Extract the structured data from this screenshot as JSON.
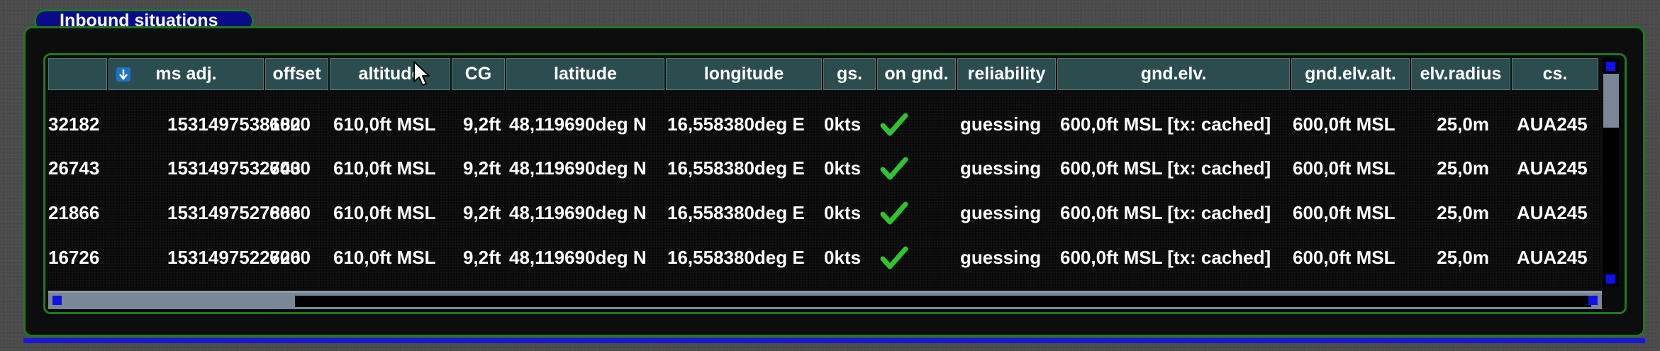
{
  "panel": {
    "title": "Inbound situations"
  },
  "table": {
    "columns": [
      {
        "key": "id",
        "label": ""
      },
      {
        "key": "ms_adj",
        "label": "ms adj."
      },
      {
        "key": "offset",
        "label": "offset"
      },
      {
        "key": "altitude",
        "label": "altitude"
      },
      {
        "key": "cg",
        "label": "CG"
      },
      {
        "key": "latitude",
        "label": "latitude"
      },
      {
        "key": "longitude",
        "label": "longitude"
      },
      {
        "key": "gs",
        "label": "gs."
      },
      {
        "key": "on_gnd",
        "label": "on gnd."
      },
      {
        "key": "reliability",
        "label": "reliability"
      },
      {
        "key": "gnd_elv",
        "label": "gnd.elv."
      },
      {
        "key": "gnd_elv_alt",
        "label": "gnd.elv.alt."
      },
      {
        "key": "elv_radius",
        "label": "elv.radius"
      },
      {
        "key": "cs",
        "label": "cs."
      }
    ],
    "sort_icon": "sort-arrow-down-icon",
    "rows": [
      {
        "id": "32182",
        "ms_adj": "1531497538182",
        "offset": "6000",
        "altitude": "610,0ft MSL",
        "cg": "9,2ft",
        "latitude": "48,119690deg N",
        "longitude": "16,558380deg E",
        "gs": "0kts",
        "on_gnd": true,
        "reliability": "guessing",
        "gnd_elv": "600,0ft MSL [tx: cached]",
        "gnd_elv_alt": "600,0ft MSL",
        "elv_radius": "25,0m",
        "cs": "AUA245"
      },
      {
        "id": "26743",
        "ms_adj": "1531497532743",
        "offset": "6000",
        "altitude": "610,0ft MSL",
        "cg": "9,2ft",
        "latitude": "48,119690deg N",
        "longitude": "16,558380deg E",
        "gs": "0kts",
        "on_gnd": true,
        "reliability": "guessing",
        "gnd_elv": "600,0ft MSL [tx: cached]",
        "gnd_elv_alt": "600,0ft MSL",
        "elv_radius": "25,0m",
        "cs": "AUA245"
      },
      {
        "id": "21866",
        "ms_adj": "1531497527866",
        "offset": "6000",
        "altitude": "610,0ft MSL",
        "cg": "9,2ft",
        "latitude": "48,119690deg N",
        "longitude": "16,558380deg E",
        "gs": "0kts",
        "on_gnd": true,
        "reliability": "guessing",
        "gnd_elv": "600,0ft MSL [tx: cached]",
        "gnd_elv_alt": "600,0ft MSL",
        "elv_radius": "25,0m",
        "cs": "AUA245"
      },
      {
        "id": "16726",
        "ms_adj": "1531497522726",
        "offset": "6000",
        "altitude": "610,0ft MSL",
        "cg": "9,2ft",
        "latitude": "48,119690deg N",
        "longitude": "16,558380deg E",
        "gs": "0kts",
        "on_gnd": true,
        "reliability": "guessing",
        "gnd_elv": "600,0ft MSL [tx: cached]",
        "gnd_elv_alt": "600,0ft MSL",
        "elv_radius": "25,0m",
        "cs": "AUA245"
      }
    ]
  },
  "colors": {
    "panel_border": "#1d7a1d",
    "title_bg": "#0b0b8a",
    "header_bg": "#2c4d4f",
    "check": "#2fc42f",
    "scroll_thumb": "#7a8796",
    "scroll_button": "#1010e8"
  }
}
